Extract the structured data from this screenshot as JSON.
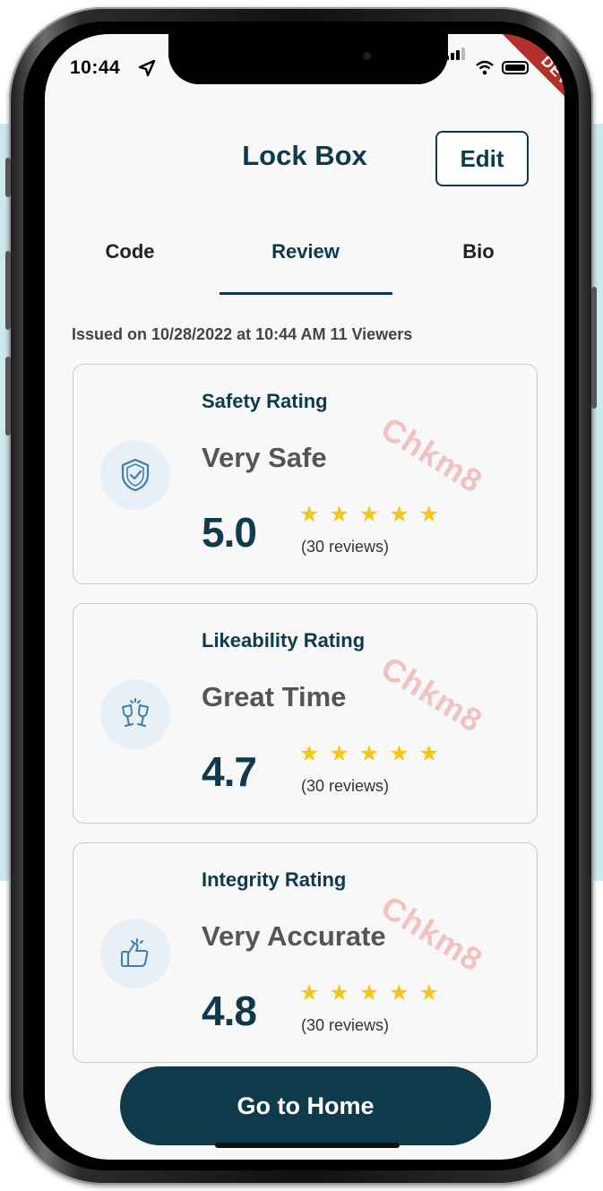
{
  "status_bar": {
    "time": "10:44",
    "banner": "DEV"
  },
  "header": {
    "title": "Lock Box",
    "edit_label": "Edit"
  },
  "tabs": [
    {
      "label": "Code"
    },
    {
      "label": "Review"
    },
    {
      "label": "Bio"
    }
  ],
  "active_tab": "Review",
  "issued_text": "Issued on 10/28/2022 at 10:44 AM 11 Viewers",
  "watermark": "Chkm8",
  "cards": [
    {
      "rating_title": "Safety Rating",
      "label": "Very Safe",
      "score": "5.0",
      "stars": "★★★★★",
      "reviews": "(30 reviews)",
      "icon": "shield-check-icon"
    },
    {
      "rating_title": "Likeability Rating",
      "label": "Great Time",
      "score": "4.7",
      "stars": "★★★★★",
      "reviews": "(30 reviews)",
      "icon": "cheers-glasses-icon"
    },
    {
      "rating_title": "Integrity Rating",
      "label": "Very Accurate",
      "score": "4.8",
      "stars": "★★★★★",
      "reviews": "(30 reviews)",
      "icon": "thumbs-up-icon"
    }
  ],
  "home_button": "Go to Home",
  "colors": {
    "primary": "#0e3a4c",
    "star": "#f5c518",
    "icon_bg": "#e6f0f6",
    "banner": "#b3302a",
    "watermark": "#f1b9b9"
  }
}
